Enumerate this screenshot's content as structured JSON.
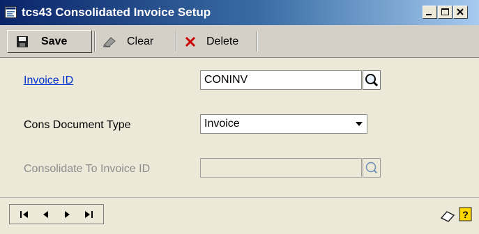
{
  "window": {
    "title": "tcs43 Consolidated Invoice Setup",
    "controls": [
      "minimize",
      "maximize",
      "close"
    ]
  },
  "toolbar": {
    "save_label": "Save",
    "clear_label": "Clear",
    "delete_label": "Delete"
  },
  "form": {
    "invoice_id": {
      "label": "Invoice ID",
      "value": "CONINV"
    },
    "cons_document_type": {
      "label": "Cons Document Type",
      "value": "Invoice"
    },
    "consolidate_to_invoice_id": {
      "label": "Consolidate To Invoice ID",
      "value": ""
    }
  },
  "navigation": [
    "first-record",
    "previous-record",
    "next-record",
    "last-record"
  ],
  "icons": {
    "app": "window-icon",
    "save": "floppy-disk-icon",
    "clear": "eraser-icon",
    "delete": "red-x-icon",
    "lookup": "magnifier-icon",
    "note": "note-icon",
    "help": "help-icon"
  },
  "colors": {
    "titlebar_start": "#0A246A",
    "titlebar_end": "#A6CAF0",
    "link": "#0033CC",
    "delete_x": "#CC0000",
    "disabled_text": "#8C8C8C"
  }
}
